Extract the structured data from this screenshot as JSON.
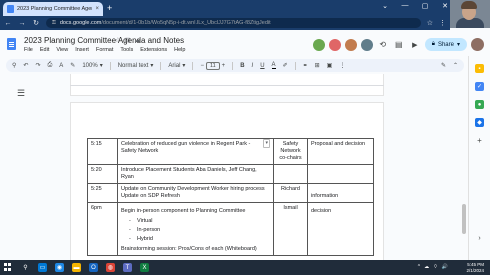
{
  "browser": {
    "tab_title": "2023 Planning Committee Agenda and Notes",
    "tab_close": "×",
    "new_tab": "+",
    "caption": [
      "⌄",
      "—",
      "▢",
      "✕"
    ],
    "nav": [
      "←",
      "→",
      "↻"
    ],
    "url_host": "docs.google.com",
    "url_path": "/document/d/1-0b1b/Wo5qN5p-i-dt.wnl.lLx_UbclJJ7G7tAG-f8ZtigJedit",
    "addr_icons": [
      "☆",
      "⋮"
    ]
  },
  "doc": {
    "title": "2023 Planning Committee Agenda and Notes",
    "title_icons": [
      "☆",
      "⊡",
      "☁"
    ],
    "menu": [
      "File",
      "Edit",
      "View",
      "Insert",
      "Format",
      "Tools",
      "Extensions",
      "Help"
    ],
    "share_label": "Share",
    "header_icons": {
      "history": "⟲",
      "comments": "▤",
      "meet": "▶"
    }
  },
  "toolbar": {
    "search": "⚲",
    "undo": "↶",
    "redo": "↷",
    "print": "⎙",
    "spellcheck": "A",
    "paint": "✎",
    "zoom": "100%",
    "style": "Normal text",
    "font": "Arial",
    "font_size": "11",
    "minus": "−",
    "plus": "+",
    "bold": "B",
    "italic": "I",
    "underline": "U",
    "textcolor": "A",
    "highlight": "✐",
    "link": "⚭",
    "comment": "⊞",
    "image": "▣",
    "more": "⋮",
    "edit_mode": "✎",
    "collapse": "⌃"
  },
  "agenda": {
    "rows": [
      {
        "time": "5:15",
        "item": "Celebration of reduced gun violence in Regent Park - Safety Network",
        "who": "Safety Network co-chairs",
        "action": "Proposal and decision"
      },
      {
        "time": "5:20",
        "item": "Introduce Placement Students Aba Daniels, Jeff Chang, Ryan",
        "who": "",
        "action": ""
      },
      {
        "time": "5:25",
        "item": "Update on Community Development Worker hiring process\nUpdate on SDP Refresh",
        "who": "Richard",
        "action": "information"
      },
      {
        "time": "6pm",
        "item": "Begin in-person component to Planning Committee",
        "sub": [
          "Virtual",
          "In-person",
          "Hybrid"
        ],
        "item_after": "Brainstorming session: Pros/Cons of each (Whiteboard)",
        "who": "Ismail",
        "action": "decision"
      }
    ]
  },
  "taskbar": {
    "time": "5:45 PM",
    "date": "2/1/2024",
    "tray": [
      "^",
      "☁",
      "⌔",
      "🔊"
    ]
  },
  "colors": {
    "chrome_frame": "#1a3d6b",
    "share_bg": "#c2e7ff",
    "taskbar": "#202c3a"
  }
}
